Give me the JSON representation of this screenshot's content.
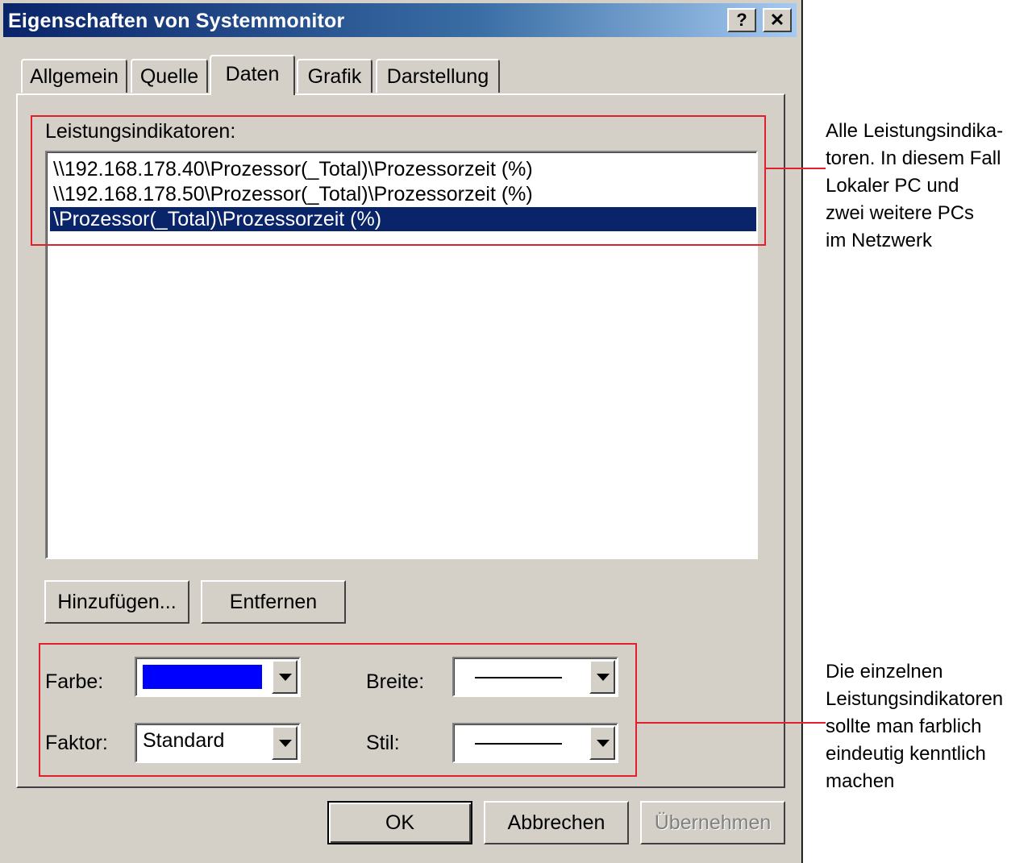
{
  "window": {
    "title": "Eigenschaften von Systemmonitor",
    "help_glyph": "?",
    "close_glyph": "✕"
  },
  "tabs": [
    {
      "label": "Allgemein",
      "active": false
    },
    {
      "label": "Quelle",
      "active": false
    },
    {
      "label": "Daten",
      "active": true
    },
    {
      "label": "Grafik",
      "active": false
    },
    {
      "label": "Darstellung",
      "active": false
    }
  ],
  "counters": {
    "label": "Leistungsindikatoren:",
    "items": [
      {
        "text": "\\\\192.168.178.40\\Prozessor(_Total)\\Prozessorzeit (%)",
        "selected": false
      },
      {
        "text": "\\\\192.168.178.50\\Prozessor(_Total)\\Prozessorzeit (%)",
        "selected": false
      },
      {
        "text": "\\Prozessor(_Total)\\Prozessorzeit (%)",
        "selected": true
      }
    ],
    "add_button": "Hinzufügen...",
    "remove_button": "Entfernen"
  },
  "properties": {
    "color_label": "Farbe:",
    "color_value": "#0000ff",
    "width_label": "Breite:",
    "factor_label": "Faktor:",
    "factor_value": "Standard",
    "style_label": "Stil:"
  },
  "footer": {
    "ok": "OK",
    "cancel": "Abbrechen",
    "apply": "Übernehmen"
  },
  "annotations": {
    "counters_note": [
      "Alle Leistungsindika-",
      "toren. In diesem Fall",
      "Lokaler PC und",
      "zwei weitere PCs",
      "im Netzwerk"
    ],
    "properties_note": [
      "Die einzelnen",
      "Leistungsindikatoren",
      "sollte man farblich",
      "eindeutig kenntlich",
      "machen"
    ],
    "highlight_color": "#e0202a"
  }
}
